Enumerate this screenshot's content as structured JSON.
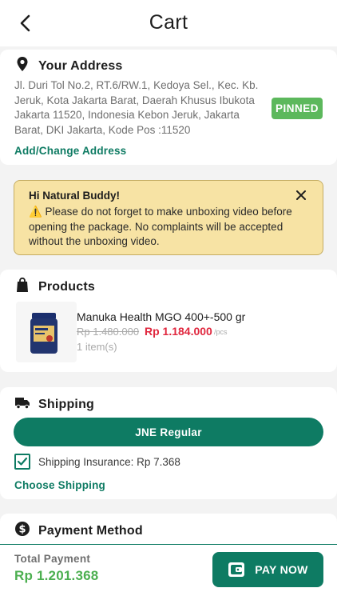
{
  "header": {
    "title": "Cart",
    "back_icon": "chevron-left-icon"
  },
  "address": {
    "title": "Your Address",
    "icon": "location-pin-icon",
    "text": "Jl. Duri Tol No.2, RT.6/RW.1, Kedoya Sel., Kec. Kb. Jeruk, Kota Jakarta Barat, Daerah Khusus Ibukota Jakarta 11520, Indonesia Kebon Jeruk, Jakarta Barat, DKI Jakarta, Kode Pos :11520",
    "pinned_label": "PINNED",
    "change_link": "Add/Change Address"
  },
  "notice": {
    "title": "Hi Natural Buddy!",
    "body": "⚠️ Please do not forget to make unboxing video before opening the package. No complaints will be accepted without the unboxing video.",
    "close_icon": "close-icon"
  },
  "products": {
    "title": "Products",
    "icon": "shopping-bag-icon",
    "items": [
      {
        "name": "Manuka Health MGO 400+-500 gr",
        "price_old": "Rp 1.480.000",
        "price_new": "Rp 1.184.000",
        "unit": "/pcs",
        "qty": "1 item(s)"
      }
    ]
  },
  "shipping": {
    "title": "Shipping",
    "icon": "truck-icon",
    "courier": "JNE Regular",
    "insurance_label": "Shipping Insurance: Rp 7.368",
    "insurance_checked": true,
    "choose_link": "Choose Shipping"
  },
  "payment": {
    "title": "Payment Method",
    "icon": "dollar-circle-icon"
  },
  "footer": {
    "total_label": "Total Payment",
    "total_value": "Rp 1.201.368",
    "pay_button": "PAY NOW",
    "pay_icon": "wallet-icon"
  },
  "colors": {
    "primary": "#0e7b63",
    "pinned": "#5cb85c",
    "price": "#e0273e",
    "notice_bg": "#f7e3a4",
    "total": "#4caf50"
  }
}
